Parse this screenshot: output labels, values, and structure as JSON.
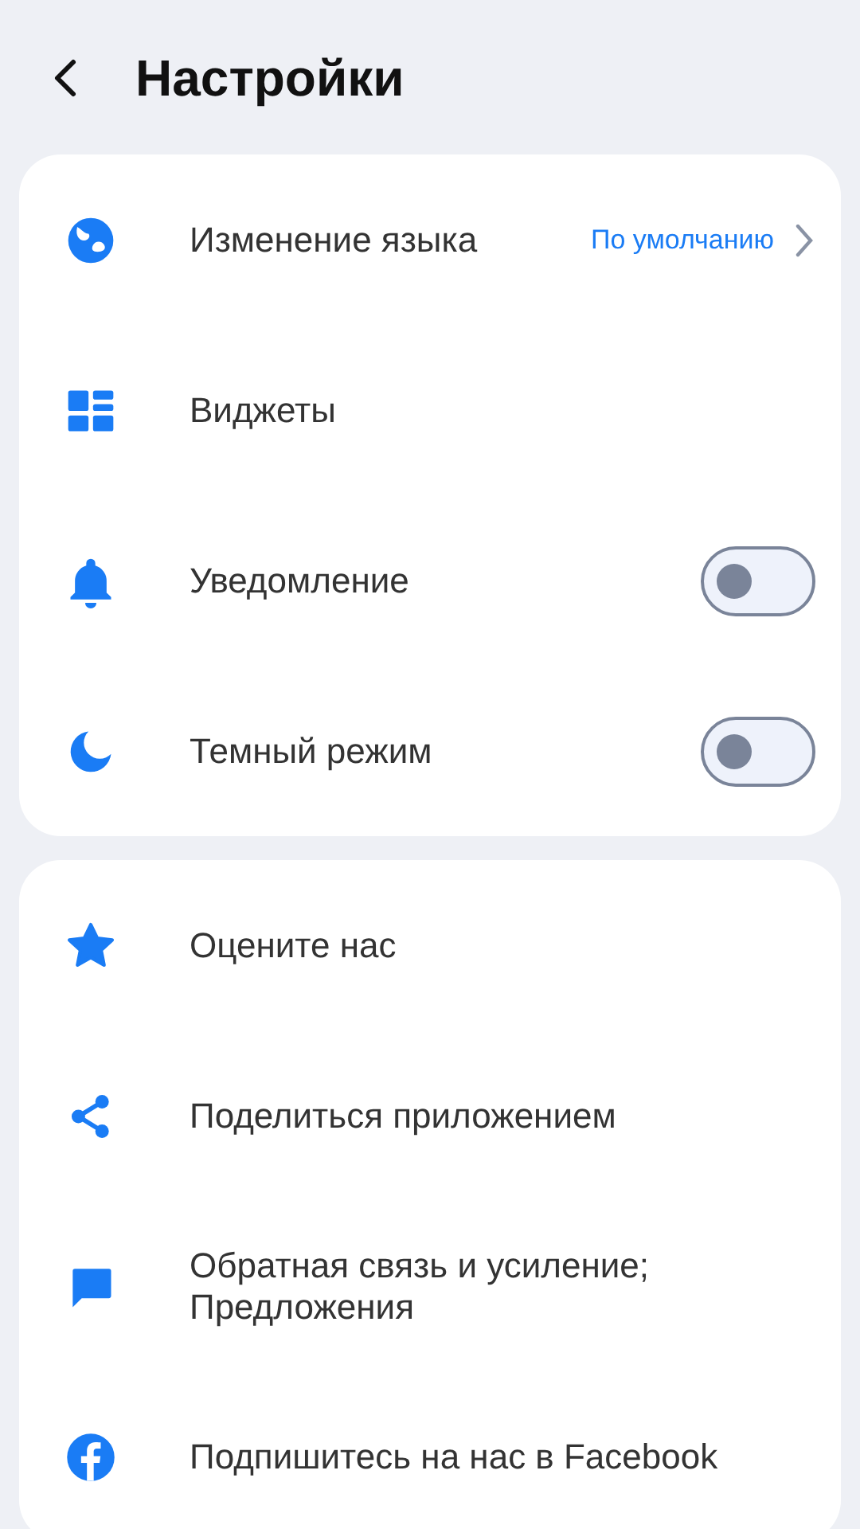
{
  "header": {
    "title": "Настройки"
  },
  "groups": [
    {
      "items": [
        {
          "kind": "link",
          "label": "Изменение языка",
          "value": "По умолчанию"
        },
        {
          "kind": "plain",
          "label": "Виджеты"
        },
        {
          "kind": "toggle",
          "label": "Уведомление",
          "on": false
        },
        {
          "kind": "toggle",
          "label": "Темный режим",
          "on": false
        }
      ]
    },
    {
      "items": [
        {
          "kind": "plain",
          "label": "Оцените нас"
        },
        {
          "kind": "plain",
          "label": "Поделиться приложением"
        },
        {
          "kind": "plain",
          "label": "Обратная связь и усиление; Предложения"
        },
        {
          "kind": "plain",
          "label": "Подпишитесь на нас в Facebook"
        }
      ]
    }
  ]
}
